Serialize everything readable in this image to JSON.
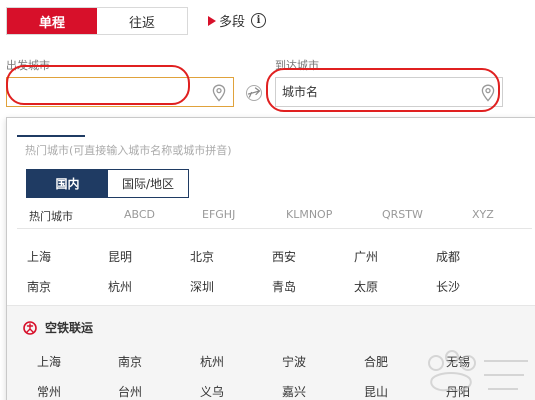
{
  "trip_types": {
    "one_way": "单程",
    "round_trip": "往返",
    "multi_city": "多段"
  },
  "from": {
    "label": "出发城市",
    "value": "",
    "placeholder": ""
  },
  "to": {
    "label": "到达城市",
    "value": "",
    "placeholder": "城市名"
  },
  "panel": {
    "hint": "热门城市(可直接输入城市名称或城市拼音)",
    "region_tabs": [
      "国内",
      "国际/地区"
    ],
    "letter_tabs": [
      "热门城市",
      "ABCD",
      "EFGHJ",
      "KLMNOP",
      "QRSTW",
      "XYZ"
    ],
    "hot_cities": [
      "上海",
      "昆明",
      "北京",
      "西安",
      "广州",
      "成都",
      "南京",
      "杭州",
      "深圳",
      "青岛",
      "太原",
      "长沙"
    ],
    "rail": {
      "title": "空铁联运",
      "cities": [
        "上海",
        "南京",
        "杭州",
        "宁波",
        "合肥",
        "无锡",
        "常州",
        "台州",
        "义乌",
        "嘉兴",
        "昆山",
        "丹阳"
      ]
    }
  },
  "colors": {
    "brand_red": "#d7102a",
    "navy": "#1f3b63",
    "focus_border": "#e0a23b",
    "annotation_red": "#e02020"
  },
  "icons": [
    "info-icon",
    "location-pin-icon",
    "swap-plane-icon",
    "railway-logo-icon"
  ]
}
